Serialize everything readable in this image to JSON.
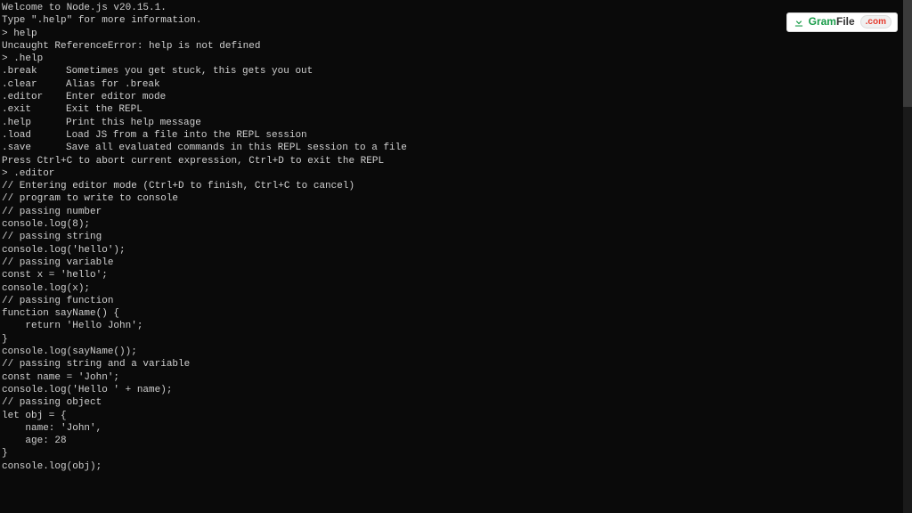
{
  "badge": {
    "part1": "Gram",
    "part2": "File",
    "dotcom": ".com"
  },
  "lines": [
    {
      "t": "Welcome to Node.js v20.15.1."
    },
    {
      "t": "Type \".help\" for more information."
    },
    {
      "t": "> help"
    },
    {
      "t": "Uncaught ReferenceError: help is not defined"
    },
    {
      "t": "> .help"
    }
  ],
  "help": [
    {
      "cmd": ".break",
      "desc": "Sometimes you get stuck, this gets you out"
    },
    {
      "cmd": ".clear",
      "desc": "Alias for .break"
    },
    {
      "cmd": ".editor",
      "desc": "Enter editor mode"
    },
    {
      "cmd": ".exit",
      "desc": "Exit the REPL"
    },
    {
      "cmd": ".help",
      "desc": "Print this help message"
    },
    {
      "cmd": ".load",
      "desc": "Load JS from a file into the REPL session"
    },
    {
      "cmd": ".save",
      "desc": "Save all evaluated commands in this REPL session to a file"
    }
  ],
  "after": [
    "",
    "Press Ctrl+C to abort current expression, Ctrl+D to exit the REPL",
    "> .editor",
    "// Entering editor mode (Ctrl+D to finish, Ctrl+C to cancel)",
    "// program to write to console",
    "",
    "// passing number",
    "console.log(8);",
    "",
    "// passing string",
    "console.log('hello');",
    "",
    "// passing variable",
    "const x = 'hello';",
    "console.log(x);",
    "",
    "// passing function",
    "function sayName() {",
    "    return 'Hello John';",
    "}",
    "console.log(sayName());",
    "",
    "// passing string and a variable",
    "const name = 'John';",
    "console.log('Hello ' + name);",
    "",
    "// passing object",
    "let obj = {",
    "    name: 'John',",
    "    age: 28",
    "}",
    "console.log(obj);"
  ]
}
